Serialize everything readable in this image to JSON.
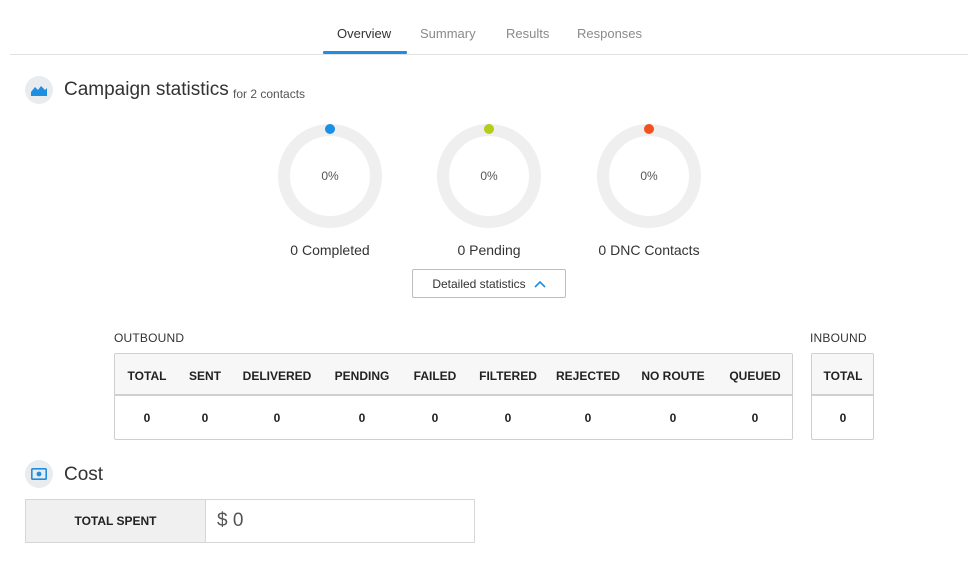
{
  "tabs": [
    {
      "label": "Overview",
      "active": true
    },
    {
      "label": "Summary",
      "active": false
    },
    {
      "label": "Results",
      "active": false
    },
    {
      "label": "Responses",
      "active": false
    }
  ],
  "campaign": {
    "title": "Campaign statistics",
    "subtitle": "for 2 contacts",
    "icon": "area-chart-icon"
  },
  "donuts": [
    {
      "percent": "0%",
      "label": "0 Completed",
      "color": "#1a8fe3"
    },
    {
      "percent": "0%",
      "label": "0 Pending",
      "color": "#b5cc18"
    },
    {
      "percent": "0%",
      "label": "0 DNC Contacts",
      "color": "#f0521e"
    }
  ],
  "detailed_button": {
    "label": "Detailed statistics",
    "icon": "chevron-up-icon"
  },
  "outbound": {
    "label": "OUTBOUND",
    "headers": [
      "TOTAL",
      "SENT",
      "DELIVERED",
      "PENDING",
      "FAILED",
      "FILTERED",
      "REJECTED",
      "NO ROUTE",
      "QUEUED"
    ],
    "values": [
      "0",
      "0",
      "0",
      "0",
      "0",
      "0",
      "0",
      "0",
      "0"
    ]
  },
  "inbound": {
    "label": "INBOUND",
    "headers": [
      "TOTAL"
    ],
    "values": [
      "0"
    ]
  },
  "cost": {
    "title": "Cost",
    "icon": "money-icon",
    "total_label": "TOTAL SPENT",
    "total_value": "$ 0"
  },
  "colors": {
    "accent": "#1f8ee0",
    "icon_bg": "#e8ecef"
  }
}
